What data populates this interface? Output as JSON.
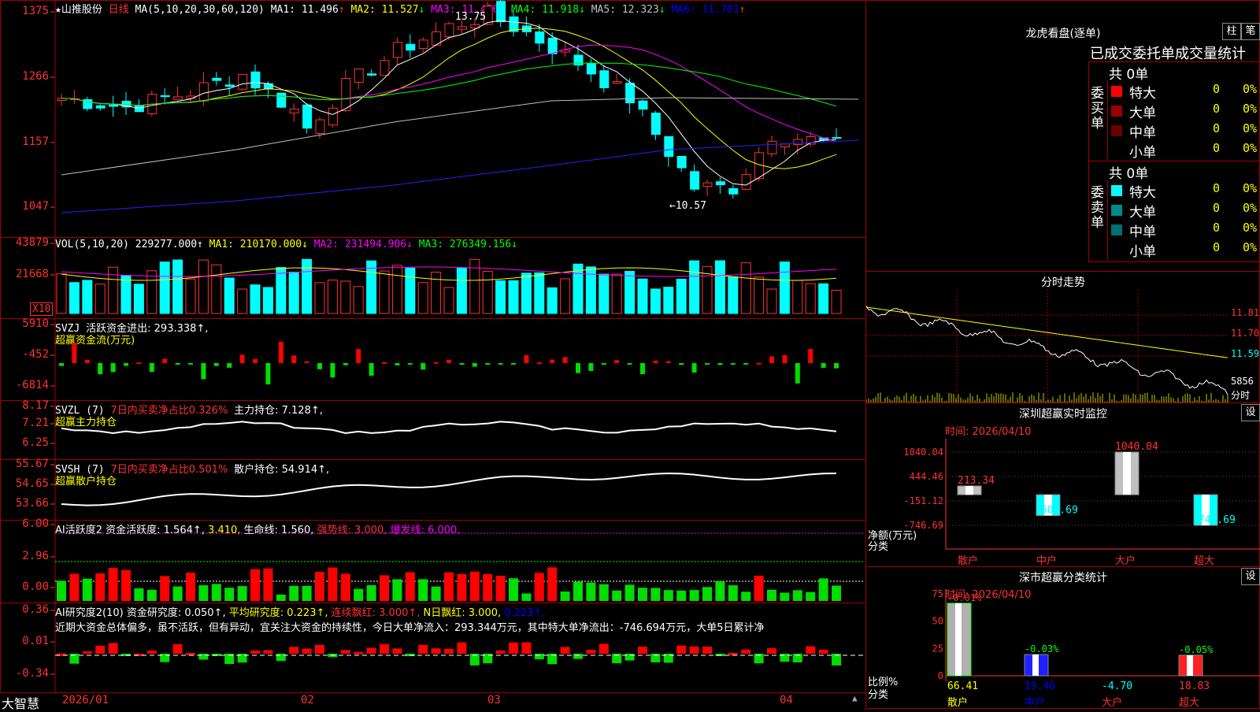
{
  "app": {
    "brand": "大智慧",
    "stock_name": "山推股份",
    "period": "日线"
  },
  "kline": {
    "ma_label": "MA(5,10,20,30,60,120)",
    "ma": [
      {
        "name": "MA1:",
        "value": "11.496",
        "arrow": "↑",
        "color": "#ffffff"
      },
      {
        "name": "MA2:",
        "value": "11.527",
        "arrow": "↓",
        "color": "#ffff00"
      },
      {
        "name": "MA3:",
        "value": "11.456",
        "arrow": "↓",
        "color": "#ff00ff"
      },
      {
        "name": "MA4:",
        "value": "11.918",
        "arrow": "↓",
        "color": "#00ff00"
      },
      {
        "name": "MA5:",
        "value": "12.323",
        "arrow": "↓",
        "color": "#c0c0c0"
      },
      {
        "name": "MA6:",
        "value": "11.701",
        "arrow": "↑",
        "color": "#0000ff"
      }
    ],
    "y_ticks": [
      "1375",
      "1266",
      "1157",
      "1047"
    ],
    "high_label": "13.75",
    "low_label": "←10.57"
  },
  "volume": {
    "label": "VOL(5,10,20)",
    "value": "229277.000↑",
    "ma": [
      {
        "text": "MA1: 210170.000↓",
        "color": "#ffff00"
      },
      {
        "text": "MA2: 231494.906↓",
        "color": "#ff00ff"
      },
      {
        "text": "MA3: 276349.156↓",
        "color": "#00ff00"
      }
    ],
    "y_ticks": [
      "43879",
      "21668"
    ],
    "unit": "X10"
  },
  "svzj": {
    "label": "SVZJ",
    "sub": "活跃资金进出: 293.338↑,",
    "title": "超赢资金流(万元)",
    "y_ticks": [
      "5910",
      "-452",
      "-6814"
    ]
  },
  "svzl": {
    "label": "SVZL (7)",
    "red": "7日内买卖净占比0.326%",
    "white": "主力持仓: 7.128↑,",
    "title": "超赢主力持仓",
    "y_ticks": [
      "8.17",
      "7.21",
      "6.25"
    ]
  },
  "svsh": {
    "label": "SVSH (7)",
    "red": "7日内买卖净占比0.501%",
    "white": "散户持仓: 54.914↑,",
    "title": "超赢散户持仓",
    "y_ticks": [
      "55.67",
      "54.65",
      "53.66"
    ]
  },
  "ai1": {
    "label": "AI活跃度2",
    "p1": "资金活跃度: 1.564↑,",
    "p2": "3.410,",
    "p3": "生命线: 1.560,",
    "p4": "强势线: 3.000,",
    "p5": "爆发线: 6.000,",
    "y_ticks": [
      "6.00",
      "2.96",
      "0.00"
    ]
  },
  "ai2": {
    "label": "AI研究度2(10)",
    "p1": "资金研究度: 0.050↑,",
    "p2": "平均研究度: 0.223↑,",
    "p3": "连续飘红: 3.000↑,",
    "p4": "N日飘红: 3.000,",
    "p5": "0.223↑,",
    "comment": "近期大资金总体偏多，虽不活跃，但有异动，宜关注大资金的持续性，今日大单净流入：293.344万元，其中特大单净流出：-746.694万元，大单5日累计净",
    "y_ticks": [
      "0.36",
      "0.01",
      "-0.34"
    ]
  },
  "x_axis": [
    "2026/01",
    "02",
    "03",
    "04"
  ],
  "lhb": {
    "title": "龙虎看盘(逐单)",
    "btn1": "柱",
    "btn2": "笔",
    "subtitle": "已成交委托单成交量统计",
    "buy_side": "委买单",
    "sell_side": "委卖单",
    "buy_total": "共 0单",
    "sell_total": "共 0单",
    "buy_rows": [
      {
        "name": "特大",
        "n": "0",
        "p": "0%",
        "color": "#ff0000"
      },
      {
        "name": "大单",
        "n": "0",
        "p": "0%",
        "color": "#9a0000"
      },
      {
        "name": "中单",
        "n": "0",
        "p": "0%",
        "color": "#6a0000"
      },
      {
        "name": "小单",
        "n": "0",
        "p": "0%",
        "color": "#000000"
      }
    ],
    "sell_rows": [
      {
        "name": "特大",
        "n": "0",
        "p": "0%",
        "color": "#00ffff"
      },
      {
        "name": "大单",
        "n": "0",
        "p": "0%",
        "color": "#008b8b"
      },
      {
        "name": "中单",
        "n": "0",
        "p": "0%",
        "color": "#007070"
      },
      {
        "name": "小单",
        "n": "0",
        "p": "0%",
        "color": "#000000"
      }
    ]
  },
  "fenshi": {
    "title": "分时走势",
    "y_ticks": [
      "11.81",
      "11.70",
      "11.59"
    ],
    "vol": "5856",
    "vol_label": "分时"
  },
  "monitor": {
    "title": "深圳超赢实时监控",
    "set": "设",
    "time": "时间: 2026/04/10",
    "y_ticks": [
      "1040.04",
      "444.46",
      "-151.12",
      "-746.69"
    ],
    "ylabel": "净额(万元)",
    "xlabel": "分类",
    "bars": [
      {
        "cat": "散户",
        "val": 213.34,
        "label": "213.34"
      },
      {
        "cat": "中户",
        "val": -506.69,
        "label": "-506.69"
      },
      {
        "cat": "大户",
        "val": 1040.04,
        "label": "1040.04"
      },
      {
        "cat": "超大",
        "val": -746.69,
        "label": "-746.69"
      }
    ]
  },
  "classify": {
    "title": "深市超赢分类统计",
    "set": "设",
    "time": "时间: 2026/04/10",
    "y_ticks": [
      "75",
      "50",
      "25",
      "0"
    ],
    "ylabel": "比例%",
    "xlabel": "分类",
    "bars": [
      {
        "cat": "散户",
        "val": 66.41,
        "top": "+0.01%"
      },
      {
        "cat": "中户",
        "val": 19.46,
        "top": "-0.03%"
      },
      {
        "cat": "大户",
        "val": -4.7,
        "top": ""
      },
      {
        "cat": "超大",
        "val": 18.83,
        "top": "-0.05%"
      }
    ]
  }
}
